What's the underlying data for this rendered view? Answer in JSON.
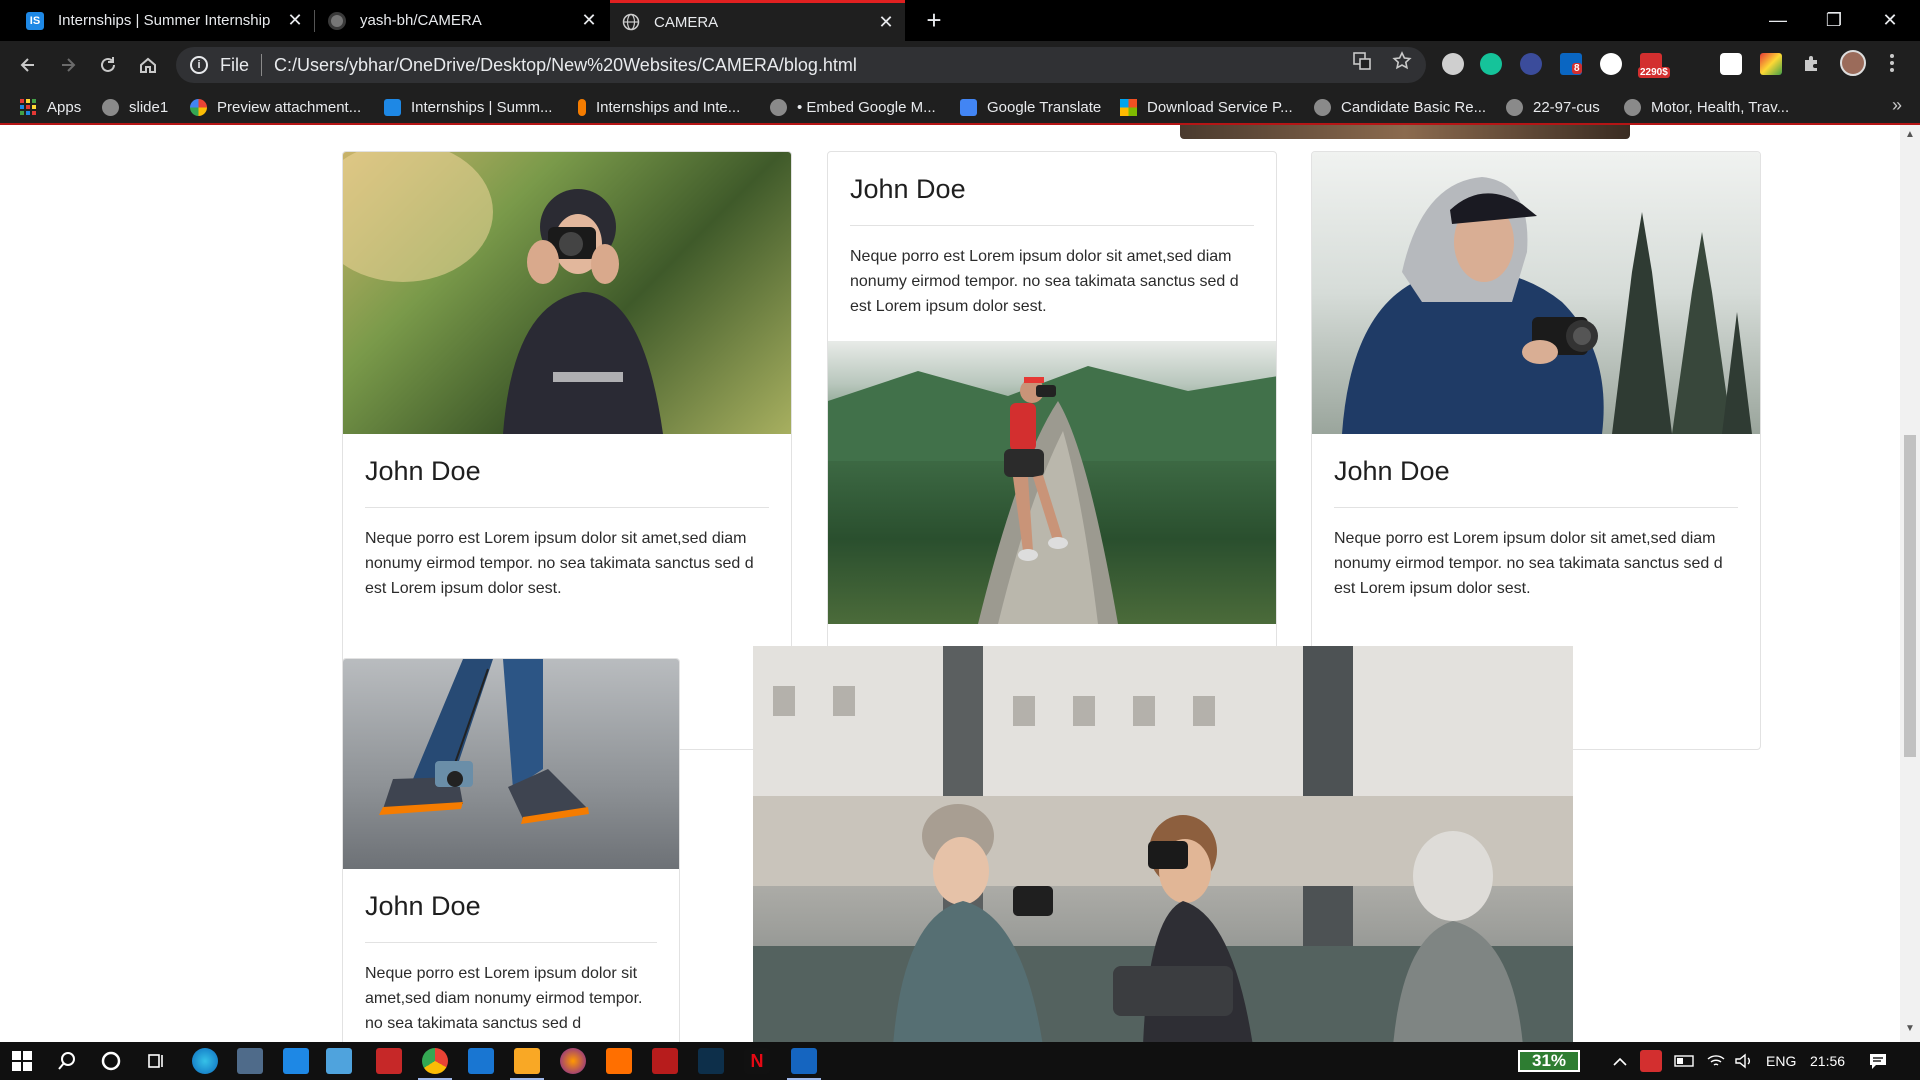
{
  "browser": {
    "tabs": [
      {
        "title": "Internships | Summer Internship",
        "favicon": "is-logo-icon",
        "active": false
      },
      {
        "title": "yash-bh/CAMERA",
        "favicon": "github-icon",
        "active": false
      },
      {
        "title": "CAMERA",
        "favicon": "globe-icon",
        "active": true
      }
    ],
    "tab_close_glyph": "✕",
    "new_tab_glyph": "+",
    "window_controls": {
      "minimize": "—",
      "restore": "❐",
      "close": "✕"
    },
    "address": {
      "scheme": "File",
      "url": "C:/Users/ybhar/OneDrive/Desktop/New%20Websites/CAMERA/blog.html"
    },
    "extension_badges": {
      "linkedin": "8",
      "mail": "2290$"
    },
    "bookmarks": [
      {
        "label": "Apps",
        "icon": "apps-grid-icon"
      },
      {
        "label": "slide1",
        "icon": "globe-icon"
      },
      {
        "label": "Preview attachment...",
        "icon": "google-icon"
      },
      {
        "label": "Internships | Summ...",
        "icon": "is-logo-icon"
      },
      {
        "label": "Internships and Inte...",
        "icon": "spark-icon"
      },
      {
        "label": "• Embed Google M...",
        "icon": "globe-icon"
      },
      {
        "label": "Google Translate",
        "icon": "translate-icon"
      },
      {
        "label": "Download Service P...",
        "icon": "microsoft-icon"
      },
      {
        "label": "Candidate Basic Re...",
        "icon": "globe-icon"
      },
      {
        "label": "22-97-cus",
        "icon": "globe-icon"
      },
      {
        "label": "Motor, Health, Trav...",
        "icon": "globe-icon"
      }
    ],
    "bookmarks_more": "»"
  },
  "page": {
    "cards": [
      {
        "id": "card-1",
        "title": "John Doe",
        "text": "Neque porro est Lorem ipsum dolor sit amet,sed diam nonumy eirmod tempor. no sea takimata sanctus sed d est Lorem ipsum dolor sest.",
        "photo": "woman-with-camera-photo"
      },
      {
        "id": "card-2",
        "title": "John Doe",
        "text": "Neque porro est Lorem ipsum dolor sit amet,sed diam nonumy eirmod tempor. no sea takimata sanctus sed d est Lorem ipsum dolor sest.",
        "photo": "mountain-photographer-photo"
      },
      {
        "id": "card-3",
        "title": "John Doe",
        "text": "Neque porro est Lorem ipsum dolor sit amet,sed diam nonumy eirmod tempor. no sea takimata sanctus sed d est Lorem ipsum dolor sest.",
        "photo": "man-in-hoodie-photo"
      },
      {
        "id": "card-4",
        "title": "John Doe",
        "text": "Neque porro est Lorem ipsum dolor sit amet,sed diam nonumy eirmod tempor. no sea takimata sanctus sed d",
        "photo": "walking-legs-camera-photo"
      }
    ],
    "wide_photo": "women-cafe-cameras-photo"
  },
  "taskbar": {
    "battery_percent": "31%",
    "language": "ENG",
    "time": "21:56"
  },
  "colors": {
    "tab_accent": "#e02020",
    "chrome_dark": "#1f1f1f",
    "battery_green": "#2e7d32"
  }
}
